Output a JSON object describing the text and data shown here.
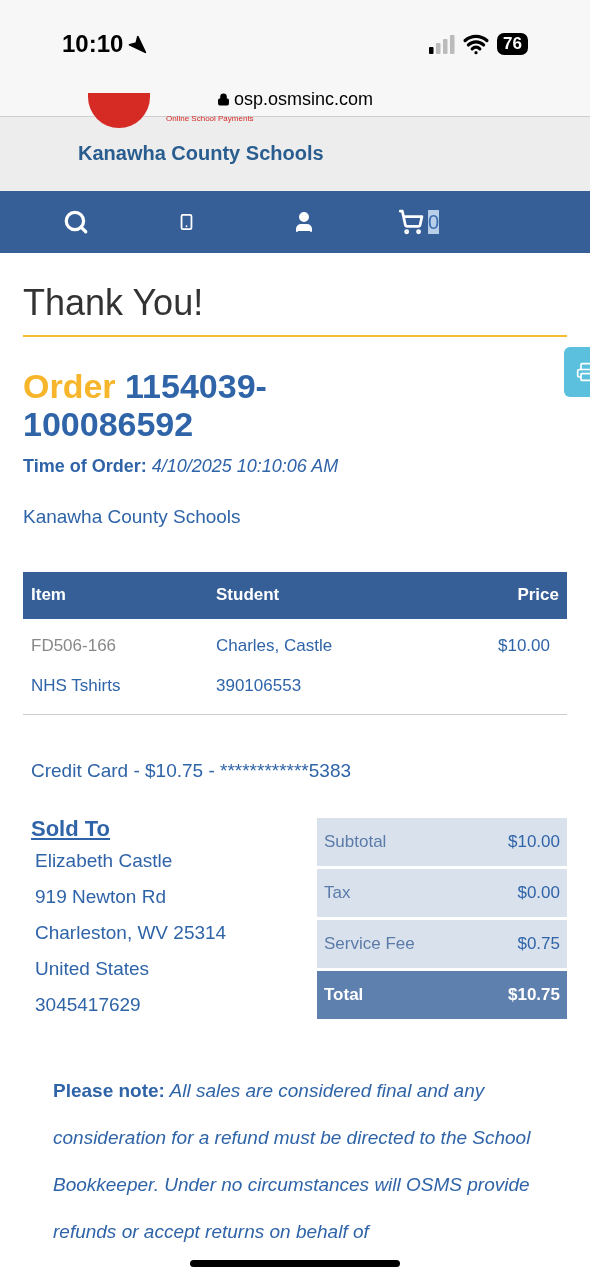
{
  "status_bar": {
    "time": "10:10",
    "battery": "76"
  },
  "browser": {
    "url": "osp.osmsinc.com"
  },
  "header": {
    "logo_tagline": "Online School Payments",
    "district": "Kanawha County Schools"
  },
  "nav": {
    "cart_count": "0"
  },
  "page": {
    "title": "Thank You!",
    "order_label": "Order",
    "order_number": "1154039-100086592",
    "time_label": "Time of Order:",
    "time_value": "4/10/2025 10:10:06 AM",
    "school": "Kanawha County Schools"
  },
  "table": {
    "columns": [
      "Item",
      "Student",
      "Price"
    ],
    "rows": [
      {
        "item": "FD506-166",
        "student": "Charles, Castle",
        "price": "$10.00"
      },
      {
        "item": "NHS Tshirts",
        "student": "390106553"
      }
    ]
  },
  "payment": "Credit Card - $10.75 - ************5383",
  "sold_to": {
    "heading": "Sold To",
    "lines": [
      "Elizabeth Castle",
      "919 Newton Rd",
      "Charleston, WV 25314",
      "United States",
      "3045417629"
    ]
  },
  "totals": [
    {
      "label": "Subtotal",
      "value": "$10.00",
      "kind": "line"
    },
    {
      "label": "Tax",
      "value": "$0.00",
      "kind": "line"
    },
    {
      "label": "Service Fee",
      "value": "$0.75",
      "kind": "line"
    },
    {
      "label": "Total",
      "value": "$10.75",
      "kind": "total"
    }
  ],
  "note": "**Please note:** All sales are considered final and any consideration for a refund must be directed to the School Bookkeeper. Under no circumstances will OSMS provide refunds or accept returns on behalf of"
}
